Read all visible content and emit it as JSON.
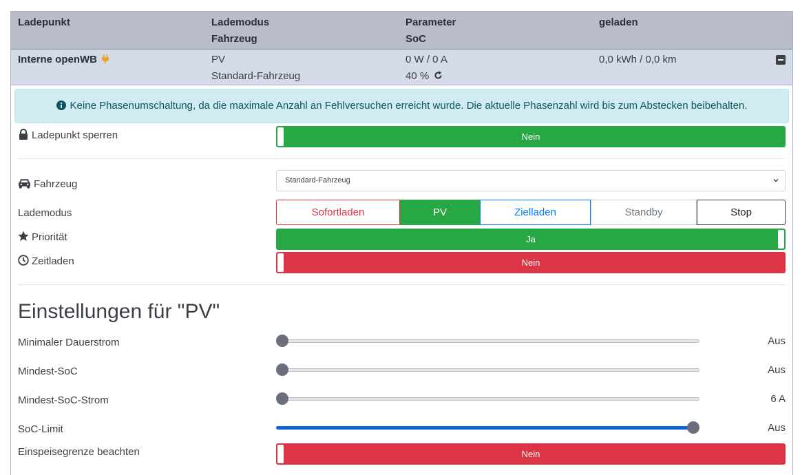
{
  "table": {
    "headers": {
      "col1": "Ladepunkt",
      "col2_line1": "Lademodus",
      "col2_line2": "Fahrzeug",
      "col3_line1": "Parameter",
      "col3_line2": "SoC",
      "col4": "geladen"
    },
    "row": {
      "name": "Interne openWB",
      "mode": "PV",
      "vehicle": "Standard-Fahrzeug",
      "power": "0 W / 0 A",
      "soc": "40 %",
      "charged": "0,0 kWh / 0,0 km"
    }
  },
  "alert": {
    "text": "Keine Phasenumschaltung, da die maximale Anzahl an Fehlversuchen erreicht wurde. Die aktuelle Phasenzahl wird bis zum Abstecken beibehalten."
  },
  "settings": {
    "lock": {
      "label": "Ladepunkt sperren",
      "value": "Nein"
    },
    "vehicle": {
      "label": "Fahrzeug",
      "selected": "Standard-Fahrzeug"
    },
    "mode": {
      "label": "Lademodus",
      "options": [
        "Sofortladen",
        "PV",
        "Zielladen",
        "Standby",
        "Stop"
      ],
      "selected": "PV"
    },
    "priority": {
      "label": "Priorität",
      "value": "Ja"
    },
    "timecharge": {
      "label": "Zeitladen",
      "value": "Nein"
    }
  },
  "pv": {
    "heading": "Einstellungen für \"PV\"",
    "min_current": {
      "label": "Minimaler Dauerstrom",
      "value": "Aus",
      "position": 0
    },
    "min_soc": {
      "label": "Mindest-SoC",
      "value": "Aus",
      "position": 0
    },
    "min_soc_current": {
      "label": "Mindest-SoC-Strom",
      "value": "6 A",
      "position": 0
    },
    "soc_limit": {
      "label": "SoC-Limit",
      "value": "Aus",
      "position": 1
    },
    "feed_in": {
      "label": "Einspeisegrenze beachten",
      "value": "Nein"
    }
  },
  "colors": {
    "header_bg": "#b8bccb",
    "row_bg": "#d5dae8",
    "green": "#28a745",
    "red": "#dc3545",
    "blue": "#007bff",
    "plug": "#f0a030"
  },
  "icons": [
    "plug-icon",
    "refresh-icon",
    "minus-square-icon",
    "info-circle-icon",
    "lock-icon",
    "car-icon",
    "star-icon",
    "clock-icon",
    "chevron-down-icon"
  ]
}
